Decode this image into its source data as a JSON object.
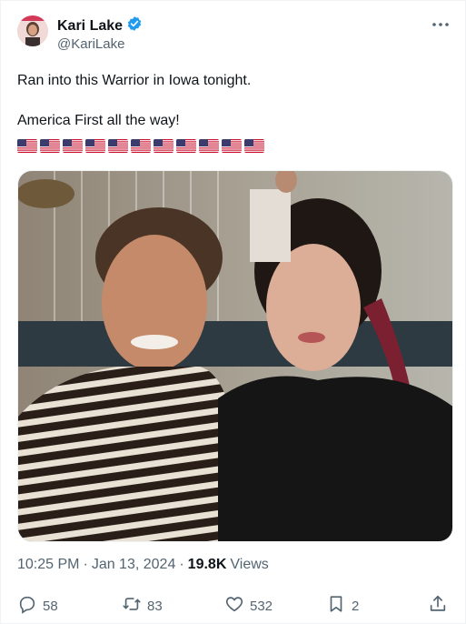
{
  "tweet": {
    "author_name": "Kari Lake",
    "author_handle": "@KariLake",
    "text": "Ran into this Warrior in Iowa tonight.\n\nAmerica First all the way!",
    "flag_count": 11,
    "flag_emoji": "🇺🇸"
  },
  "meta": {
    "time": "10:25 PM",
    "separator1": "·",
    "date": "Jan 13, 2024",
    "separator2": "·",
    "views_count": "19.8K",
    "views_label": "Views"
  },
  "actions": {
    "replies": "58",
    "reposts": "83",
    "likes": "532",
    "bookmarks": "2"
  },
  "icons": {
    "verified": "verified-badge-icon",
    "more": "more-options-icon",
    "reply": "reply-icon",
    "repost": "repost-icon",
    "like": "heart-icon",
    "bookmark": "bookmark-icon",
    "share": "share-icon"
  },
  "colors": {
    "text": "#0f1419",
    "secondary": "#536471",
    "verified": "#1d9bf0"
  }
}
